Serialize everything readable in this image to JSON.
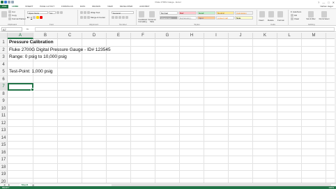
{
  "window": {
    "title": "Fluke 2700G Gauge - Excel",
    "controls": [
      "?",
      "—",
      "□",
      "✕"
    ]
  },
  "ribbon": {
    "file_tab": "FILE",
    "tabs": [
      "HOME",
      "INSERT",
      "PAGE LAYOUT",
      "FORMULAS",
      "DATA",
      "REVIEW",
      "VIEW",
      "DEVELOPER",
      "ACROBAT"
    ],
    "signed_in_user": "Nathan Hager",
    "clipboard": {
      "paste": "Paste",
      "cut": "Cut",
      "copy": "Copy",
      "format_painter": "Format Painter",
      "group": "Clipboard"
    },
    "font": {
      "name": "Open Sans",
      "size": "11",
      "group": "Font"
    },
    "alignment": {
      "wrap_text": "Wrap Text",
      "merge_center": "Merge & Center",
      "group": "Alignment"
    },
    "number": {
      "format": "General",
      "group": "Number"
    },
    "styles": {
      "conditional": "Conditional Formatting",
      "format_table": "Format as Table",
      "cells": [
        {
          "label": "Normal",
          "bg": "#ffffff",
          "fg": "#000000"
        },
        {
          "label": "Bad",
          "bg": "#ffc7ce",
          "fg": "#9c0006"
        },
        {
          "label": "Good",
          "bg": "#c6efce",
          "fg": "#006100"
        },
        {
          "label": "Neutral",
          "bg": "#ffeb9c",
          "fg": "#9c5700"
        },
        {
          "label": "Calculation",
          "bg": "#f2f2f2",
          "fg": "#fa7d00"
        },
        {
          "label": "Check Cell",
          "bg": "#a5a5a5",
          "fg": "#ffffff"
        },
        {
          "label": "Explanatory...",
          "bg": "#ffffff",
          "fg": "#7f7f7f"
        },
        {
          "label": "Input",
          "bg": "#ffcc99",
          "fg": "#3f3f76"
        },
        {
          "label": "Linked Cell",
          "bg": "#ffffff",
          "fg": "#fa7d00"
        },
        {
          "label": "Note",
          "bg": "#ffffcc",
          "fg": "#000000"
        }
      ],
      "group": "Styles"
    },
    "cells_group": {
      "insert": "Insert",
      "delete": "Delete",
      "format": "Format",
      "group": "Cells"
    },
    "editing": {
      "autosum": "AutoSum",
      "fill": "Fill",
      "clear": "Clear",
      "sort_filter": "Sort & Filter",
      "find_select": "Find & Select",
      "group": "Editing"
    }
  },
  "formula_bar": {
    "name_box": "A7",
    "fx": "fx",
    "value": ""
  },
  "sheet": {
    "columns": [
      "A",
      "B",
      "C",
      "D",
      "E",
      "F",
      "G",
      "H",
      "I",
      "J",
      "K",
      "L",
      "M"
    ],
    "rows": [
      "1",
      "2",
      "3",
      "4",
      "5",
      "6",
      "7",
      "8",
      "9",
      "10",
      "11",
      "12",
      "13",
      "14",
      "15",
      "16",
      "17",
      "18",
      "19",
      "20",
      "21"
    ],
    "active_column": "A",
    "active_row": "7",
    "content": {
      "a1": "Pressure Calibration",
      "a2": "Fluke 2700G Digital Pressure Gauge - ID# 123545",
      "a3": "Range: 0 psig to 10,000 psig",
      "a5": "Test-Point: 1,000 psig"
    }
  },
  "sheet_tabs": {
    "active": "Sheet1",
    "add": "⊕"
  },
  "status": {
    "ready": "READY",
    "zoom": "100%"
  },
  "colors": {
    "accent": "#217346"
  }
}
